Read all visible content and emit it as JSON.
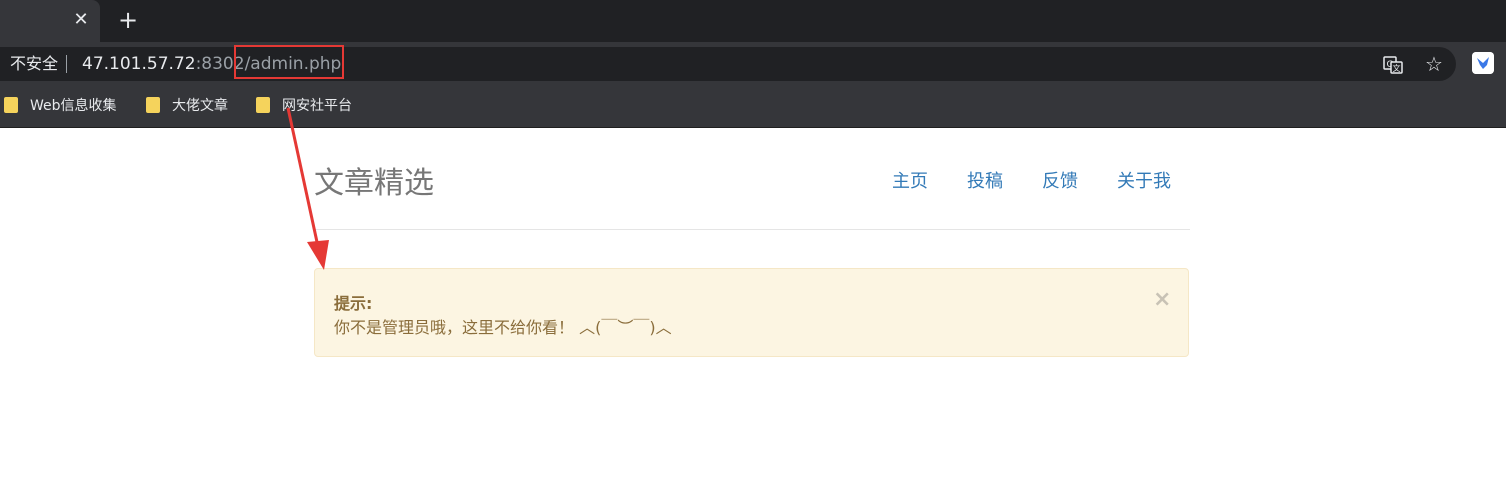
{
  "browser": {
    "tab_close": "✕",
    "new_tab": "+",
    "security_label": "不安全",
    "url_host": "47.101.57.72",
    "url_port": ":8302",
    "url_slash": "/",
    "url_path": "admin.php",
    "star": "☆",
    "bookmarks": [
      "Web信息收集",
      "大佬文章",
      "网安社平台"
    ]
  },
  "page": {
    "brand": "文章精选",
    "nav": [
      "主页",
      "投稿",
      "反馈",
      "关于我"
    ],
    "alert": {
      "title": "提示:",
      "message": "你不是管理员哦，这里不给你看！ ︿(￣︶￣)︿",
      "close": "×"
    }
  },
  "colors": {
    "highlight": "#e53935",
    "link": "#337ab7",
    "alert_bg": "#fcf5e2",
    "alert_text": "#8a6d3b"
  }
}
